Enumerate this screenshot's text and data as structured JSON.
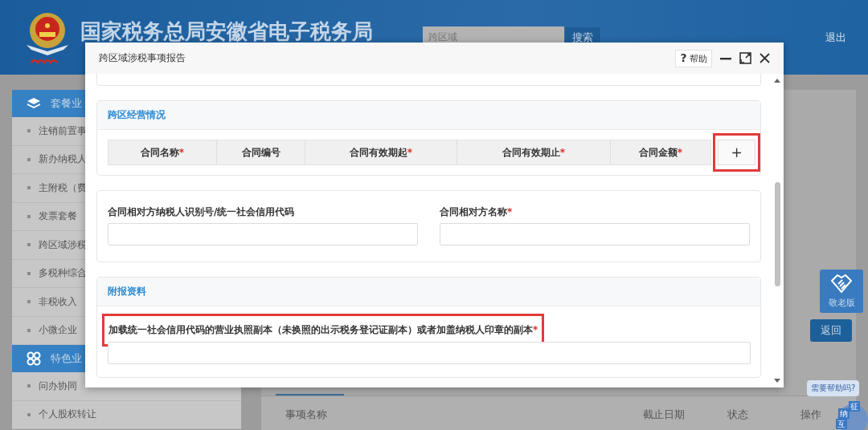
{
  "header": {
    "title": "国家税务总局安徽省电子税务局",
    "search": {
      "value": "跨区域",
      "button": "搜索"
    },
    "logout": "退出"
  },
  "sidebar": {
    "groups": [
      {
        "kind": "layers",
        "title": "套餐业",
        "items": [
          "注销前置事",
          "新办纳税人",
          "主附税（费",
          "发票套餐",
          "跨区域涉税",
          "多税种综合",
          "非税收入",
          "小微企业"
        ]
      },
      {
        "kind": "clover",
        "title": "特色业",
        "items": [
          "问办协同",
          "个人股权转让"
        ]
      }
    ]
  },
  "main": {
    "elder_button": "敬老版",
    "back_button": "返回",
    "table": {
      "columns": [
        "事项名称",
        "截止日期",
        "状态",
        "操作"
      ]
    }
  },
  "assistant": {
    "bubble": "需要帮助吗?",
    "badges": [
      "征",
      "纳",
      "互"
    ]
  },
  "dialog": {
    "title": "跨区域涉税事项报告",
    "help": {
      "icon": "?",
      "label": "帮助"
    },
    "required_mark": "*",
    "contract_section": {
      "title": "跨区经营情况",
      "columns": [
        {
          "label": "合同名称",
          "required": true
        },
        {
          "label": "合同编号",
          "required": false
        },
        {
          "label": "合同有效期起",
          "required": true
        },
        {
          "label": "合同有效期止",
          "required": true
        },
        {
          "label": "合同金额",
          "required": true
        }
      ],
      "add_button": {
        "label": "+",
        "highlighted": true
      }
    },
    "counterparty_section": {
      "fields": [
        {
          "label": "合同相对方纳税人识别号/统一社会信用代码",
          "required": false
        },
        {
          "label": "合同相对方名称",
          "required": true
        }
      ]
    },
    "attachment_section": {
      "title": "附报资料",
      "field": {
        "label": "加载统一社会信用代码的营业执照副本（未换照的出示税务登记证副本）或者加盖纳税人印章的副本",
        "required": true,
        "highlighted": true
      }
    }
  }
}
